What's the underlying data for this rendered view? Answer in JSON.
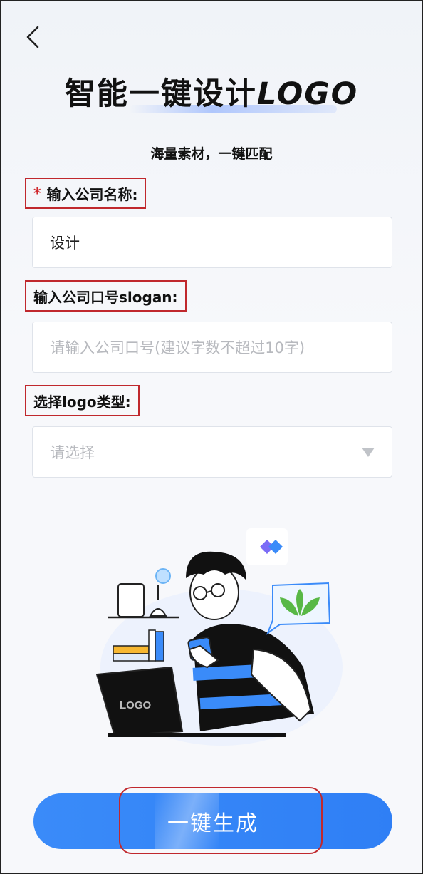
{
  "header": {
    "title_cn": "智能一键设计",
    "title_latin": "LOGO",
    "subtitle": "海量素材，一键匹配"
  },
  "form": {
    "company_name": {
      "required_mark": "*",
      "label": "输入公司名称:",
      "value": "设计"
    },
    "slogan": {
      "label": "输入公司口号slogan:",
      "placeholder": "请输入公司口号(建议字数不超过10字)"
    },
    "logo_type": {
      "label": "选择logo类型:",
      "selected": "请选择"
    }
  },
  "illustration": {
    "laptop_text": "LOGO"
  },
  "cta": {
    "label": "一键生成"
  },
  "colors": {
    "primary": "#2f80f6",
    "highlight_border": "#c0282d",
    "required": "#d0282d"
  },
  "icons": [
    "back-chevron-icon",
    "dropdown-arrow-icon"
  ]
}
